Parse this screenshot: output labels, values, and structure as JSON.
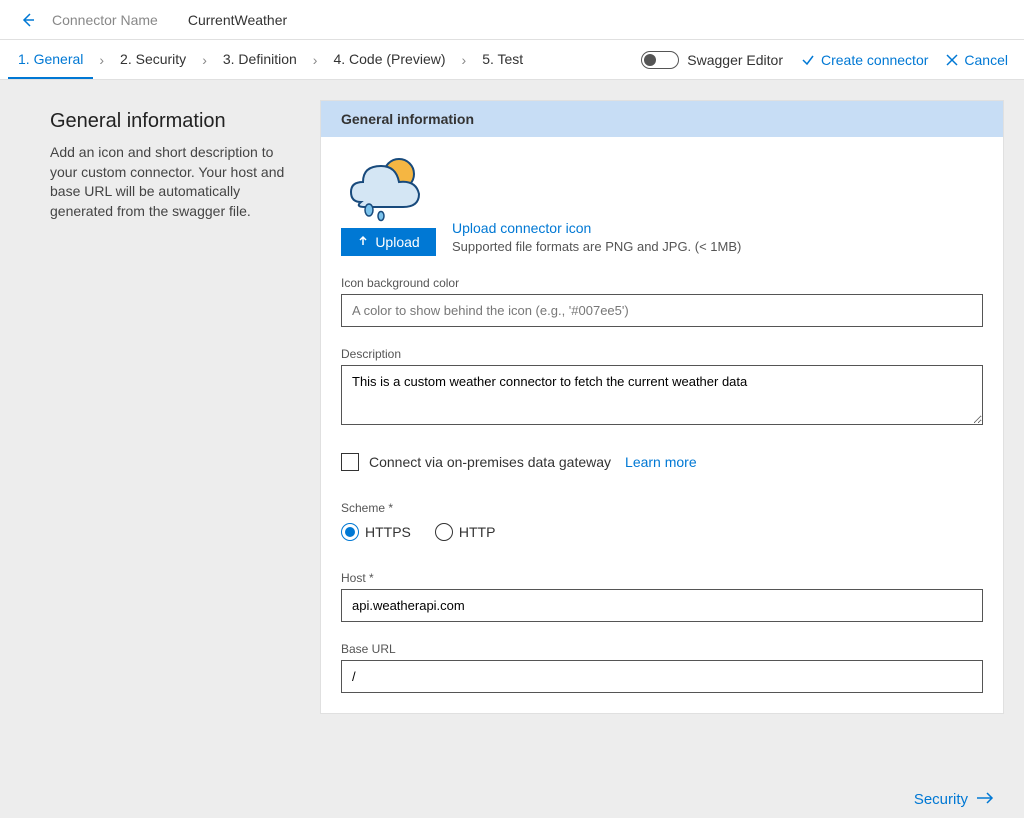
{
  "header": {
    "connector_label": "Connector Name",
    "connector_name": "CurrentWeather"
  },
  "tabs": [
    {
      "label": "1. General",
      "active": true
    },
    {
      "label": "2. Security",
      "active": false
    },
    {
      "label": "3. Definition",
      "active": false
    },
    {
      "label": "4. Code (Preview)",
      "active": false
    },
    {
      "label": "5. Test",
      "active": false
    }
  ],
  "actions": {
    "swagger_editor": "Swagger Editor",
    "create_connector": "Create connector",
    "cancel": "Cancel"
  },
  "left": {
    "title": "General information",
    "description": "Add an icon and short description to your custom connector. Your host and base URL will be automatically generated from the swagger file."
  },
  "panel": {
    "header": "General information",
    "upload_button": "Upload",
    "upload_link": "Upload connector icon",
    "supported_formats": "Supported file formats are PNG and JPG. (< 1MB)",
    "icon_bg_label": "Icon background color",
    "icon_bg_placeholder": "A color to show behind the icon (e.g., '#007ee5')",
    "icon_bg_value": "",
    "description_label": "Description",
    "description_value": "This is a custom weather connector to fetch the current weather data",
    "gateway_label": "Connect via on-premises data gateway",
    "learn_more": "Learn more",
    "scheme_label": "Scheme *",
    "scheme_options": {
      "https": "HTTPS",
      "http": "HTTP"
    },
    "scheme_selected": "https",
    "host_label": "Host *",
    "host_value": "api.weatherapi.com",
    "base_url_label": "Base URL",
    "base_url_value": "/"
  },
  "footer": {
    "next_label": "Security"
  }
}
